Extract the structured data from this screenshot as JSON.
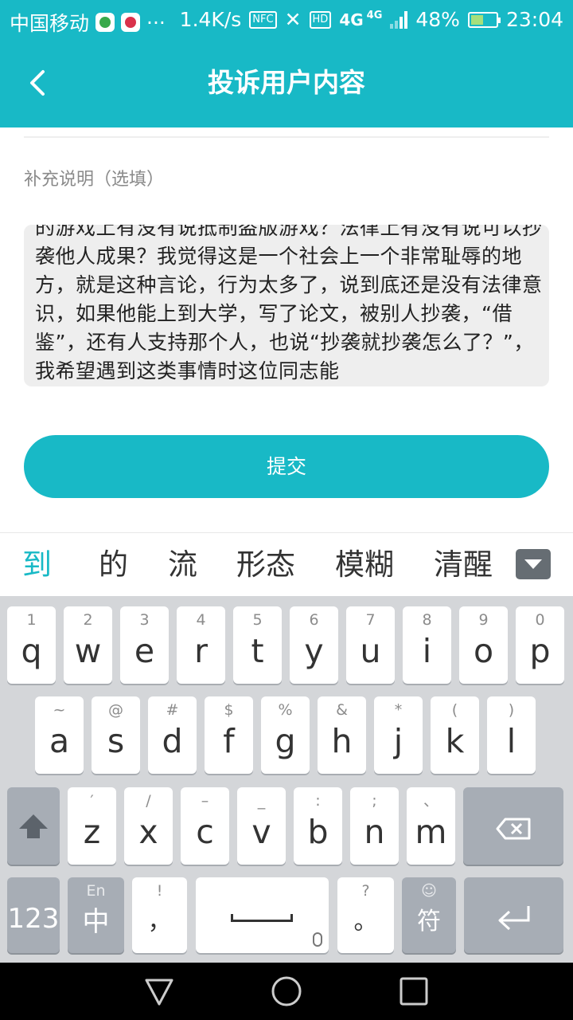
{
  "status_bar": {
    "carrier": "中国移动",
    "more": "···",
    "speed": "1.4K/s",
    "nfc": "NFC",
    "hd": "HD",
    "network": "4G",
    "network_small": "4G",
    "battery": "48%",
    "time": "23:04"
  },
  "header": {
    "back_icon": "chevron-left-icon",
    "back_symbol": "‹",
    "title": "投诉用户内容",
    "color": "#18b9c6"
  },
  "form": {
    "label": "补充说明（选填）",
    "text": "的游戏上有没有说抵制盗版游戏？法律上有没有说可以抄袭他人成果？我觉得这是一个社会上一个非常耻辱的地方，就是这种言论，行为太多了，说到底还是没有法律意识，如果他能上到大学，写了论文，被别人抄袭，“借鉴”，还有人支持那个人，也说“抄袭就抄袭怎么了？”，我希望遇到这类事情时这位同志能",
    "submit": "提交"
  },
  "candidates": [
    "到",
    "的",
    "流",
    "形态",
    "模糊",
    "清醒"
  ],
  "keyboard": {
    "row1": [
      {
        "sec": "1",
        "pri": "q"
      },
      {
        "sec": "2",
        "pri": "w"
      },
      {
        "sec": "3",
        "pri": "e"
      },
      {
        "sec": "4",
        "pri": "r"
      },
      {
        "sec": "5",
        "pri": "t"
      },
      {
        "sec": "6",
        "pri": "y"
      },
      {
        "sec": "7",
        "pri": "u"
      },
      {
        "sec": "8",
        "pri": "i"
      },
      {
        "sec": "9",
        "pri": "o"
      },
      {
        "sec": "0",
        "pri": "p"
      }
    ],
    "row2": [
      {
        "sec": "~",
        "pri": "a"
      },
      {
        "sec": "@",
        "pri": "s"
      },
      {
        "sec": "#",
        "pri": "d"
      },
      {
        "sec": "$",
        "pri": "f"
      },
      {
        "sec": "%",
        "pri": "g"
      },
      {
        "sec": "&",
        "pri": "h"
      },
      {
        "sec": "*",
        "pri": "j"
      },
      {
        "sec": "(",
        "pri": "k"
      },
      {
        "sec": ")",
        "pri": "l"
      }
    ],
    "row3": [
      {
        "sec": "′",
        "pri": "z"
      },
      {
        "sec": "/",
        "pri": "x"
      },
      {
        "sec": "–",
        "pri": "c"
      },
      {
        "sec": "_",
        "pri": "v"
      },
      {
        "sec": ":",
        "pri": "b"
      },
      {
        "sec": ";",
        "pri": "n"
      },
      {
        "sec": "、",
        "pri": "m"
      }
    ],
    "num_key": "123",
    "lang_key": {
      "sec": "En",
      "pri": "中"
    },
    "comma_key": {
      "sec": "!",
      "pri": "，"
    },
    "period_key": {
      "sec": "?",
      "pri": "。"
    },
    "symbol_key": {
      "sec": "☺",
      "pri": "符"
    }
  }
}
